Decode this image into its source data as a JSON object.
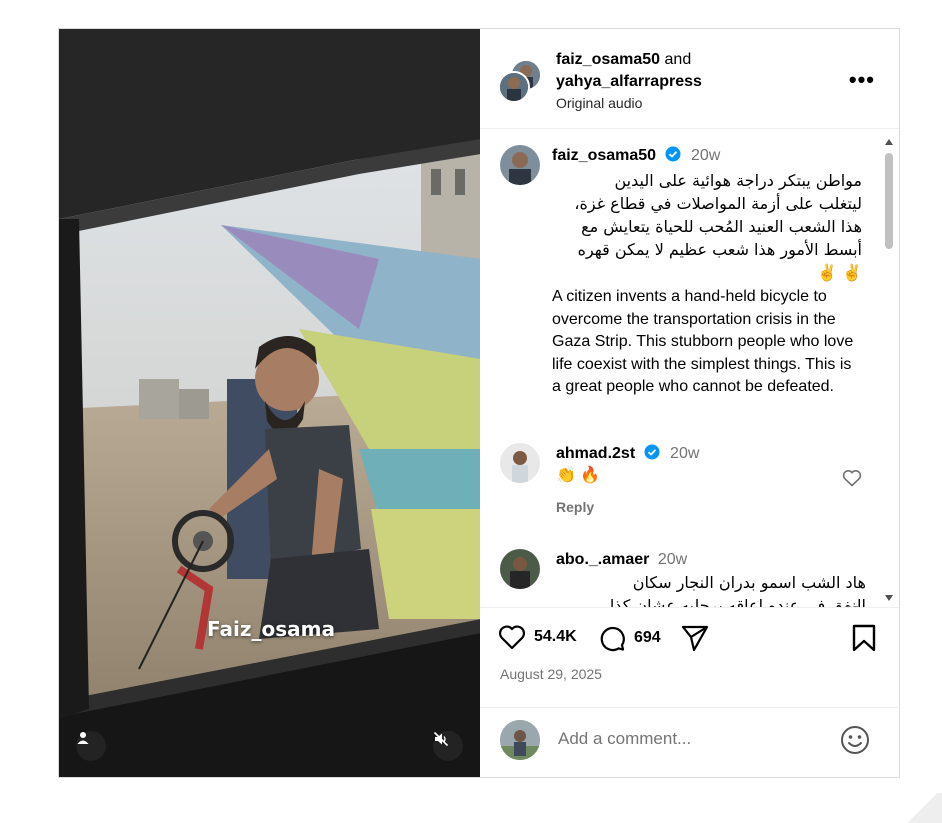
{
  "header": {
    "user1": "faiz_osama50",
    "and": "and",
    "user2": "yahya_alfarrapress",
    "audio": "Original audio",
    "more": "•••"
  },
  "media": {
    "watermark": "Faiz_osama"
  },
  "caption": {
    "username": "faiz_osama50",
    "time": "20w",
    "arabic_lines": [
      "مواطن يبتكر دراجة هوائية على اليدين",
      "ليتغلب على أزمة المواصلات في قطاع غزة،",
      "هذا الشعب العنيد المُحب للحياة يتعايش مع",
      "أبسط الأمور هذا شعب عظيم لا يمكن قهره",
      "✌️ ✌️"
    ],
    "english": "A citizen invents a hand-held bicycle to overcome the transportation crisis in the Gaza Strip. This stubborn people who love life coexist with the simplest things. This is a great people who cannot be defeated."
  },
  "comments": [
    {
      "username": "ahmad.2st",
      "time": "20w",
      "text": "👏 🔥",
      "reply": "Reply"
    },
    {
      "username": "abo._.amaer",
      "time": "20w",
      "line1": "هاد الشب اسمو بدران النجار سكان",
      "line2": "النفق في عنده اعاقه برجليه عشان كذا"
    }
  ],
  "actions": {
    "likes": "54.4K",
    "comments": "694",
    "date": "August 29, 2025"
  },
  "add_comment": {
    "placeholder": "Add a comment..."
  },
  "colors": {
    "verified": "#0095f6",
    "muted_text": "#737373",
    "border": "#dbdbdb"
  }
}
